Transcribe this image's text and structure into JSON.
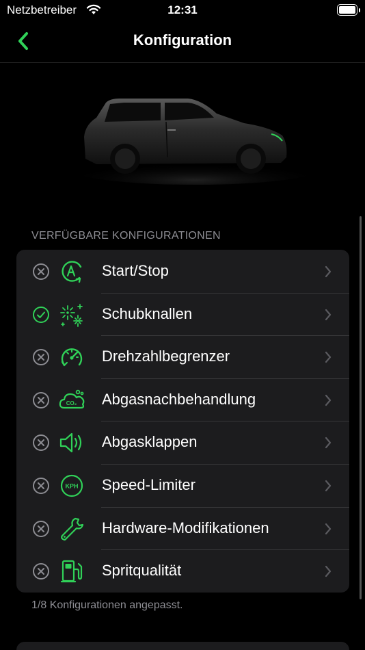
{
  "status_bar": {
    "carrier": "Netzbetreiber",
    "time": "12:31"
  },
  "nav": {
    "title": "Konfiguration"
  },
  "section": {
    "header": "VERFÜGBARE KONFIGURATIONEN",
    "footer": "1/8 Konfigurationen angepasst."
  },
  "items": [
    {
      "label": "Start/Stop",
      "icon": "auto-start-stop-icon",
      "status": "not-adjusted"
    },
    {
      "label": "Schubknallen",
      "icon": "fireworks-icon",
      "status": "adjusted"
    },
    {
      "label": "Drehzahlbegrenzer",
      "icon": "rev-limiter-icon",
      "status": "not-adjusted"
    },
    {
      "label": "Abgasnachbehandlung",
      "icon": "co2-cloud-icon",
      "status": "not-adjusted"
    },
    {
      "label": "Abgasklappen",
      "icon": "speaker-icon",
      "status": "not-adjusted"
    },
    {
      "label": "Speed-Limiter",
      "icon": "kph-icon",
      "status": "not-adjusted"
    },
    {
      "label": "Hardware-Modifikationen",
      "icon": "wrench-icon",
      "status": "not-adjusted"
    },
    {
      "label": "Spritqualität",
      "icon": "fuel-pump-icon",
      "status": "not-adjusted"
    }
  ],
  "colors": {
    "accent": "#30d158",
    "background": "#000000",
    "card": "#1c1c1e",
    "secondary_text": "#8d8d93"
  }
}
